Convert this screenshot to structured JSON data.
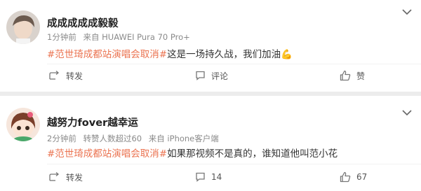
{
  "posts": [
    {
      "username": "成成成成成毅毅",
      "time": "1分钟前",
      "source": "来自 HUAWEI Pura 70 Pro+",
      "forward_count": "",
      "hashtag": "#范世琦成都站演唱会取消#",
      "text": "这是一场持久战，我们加油",
      "emoji": "💪",
      "repost_label": "转发",
      "comment_label": "评论",
      "like_label": "赞"
    },
    {
      "username": "越努力fover越幸运",
      "time": "2分钟前",
      "forward_count": "转赞人数超过60",
      "source": "来自 iPhone客户端",
      "hashtag": "#范世琦成都站演唱会取消#",
      "text": "如果那视频不是真的，谁知道他叫范小花",
      "emoji": "",
      "repost_label": "转发",
      "comment_label": "14",
      "like_label": "67"
    }
  ],
  "colors": {
    "hashtag": "#eb7350",
    "meta": "#8a8a8a"
  },
  "icons": [
    "chevron-down-icon",
    "repost-icon",
    "comment-icon",
    "thumbs-up-icon"
  ]
}
